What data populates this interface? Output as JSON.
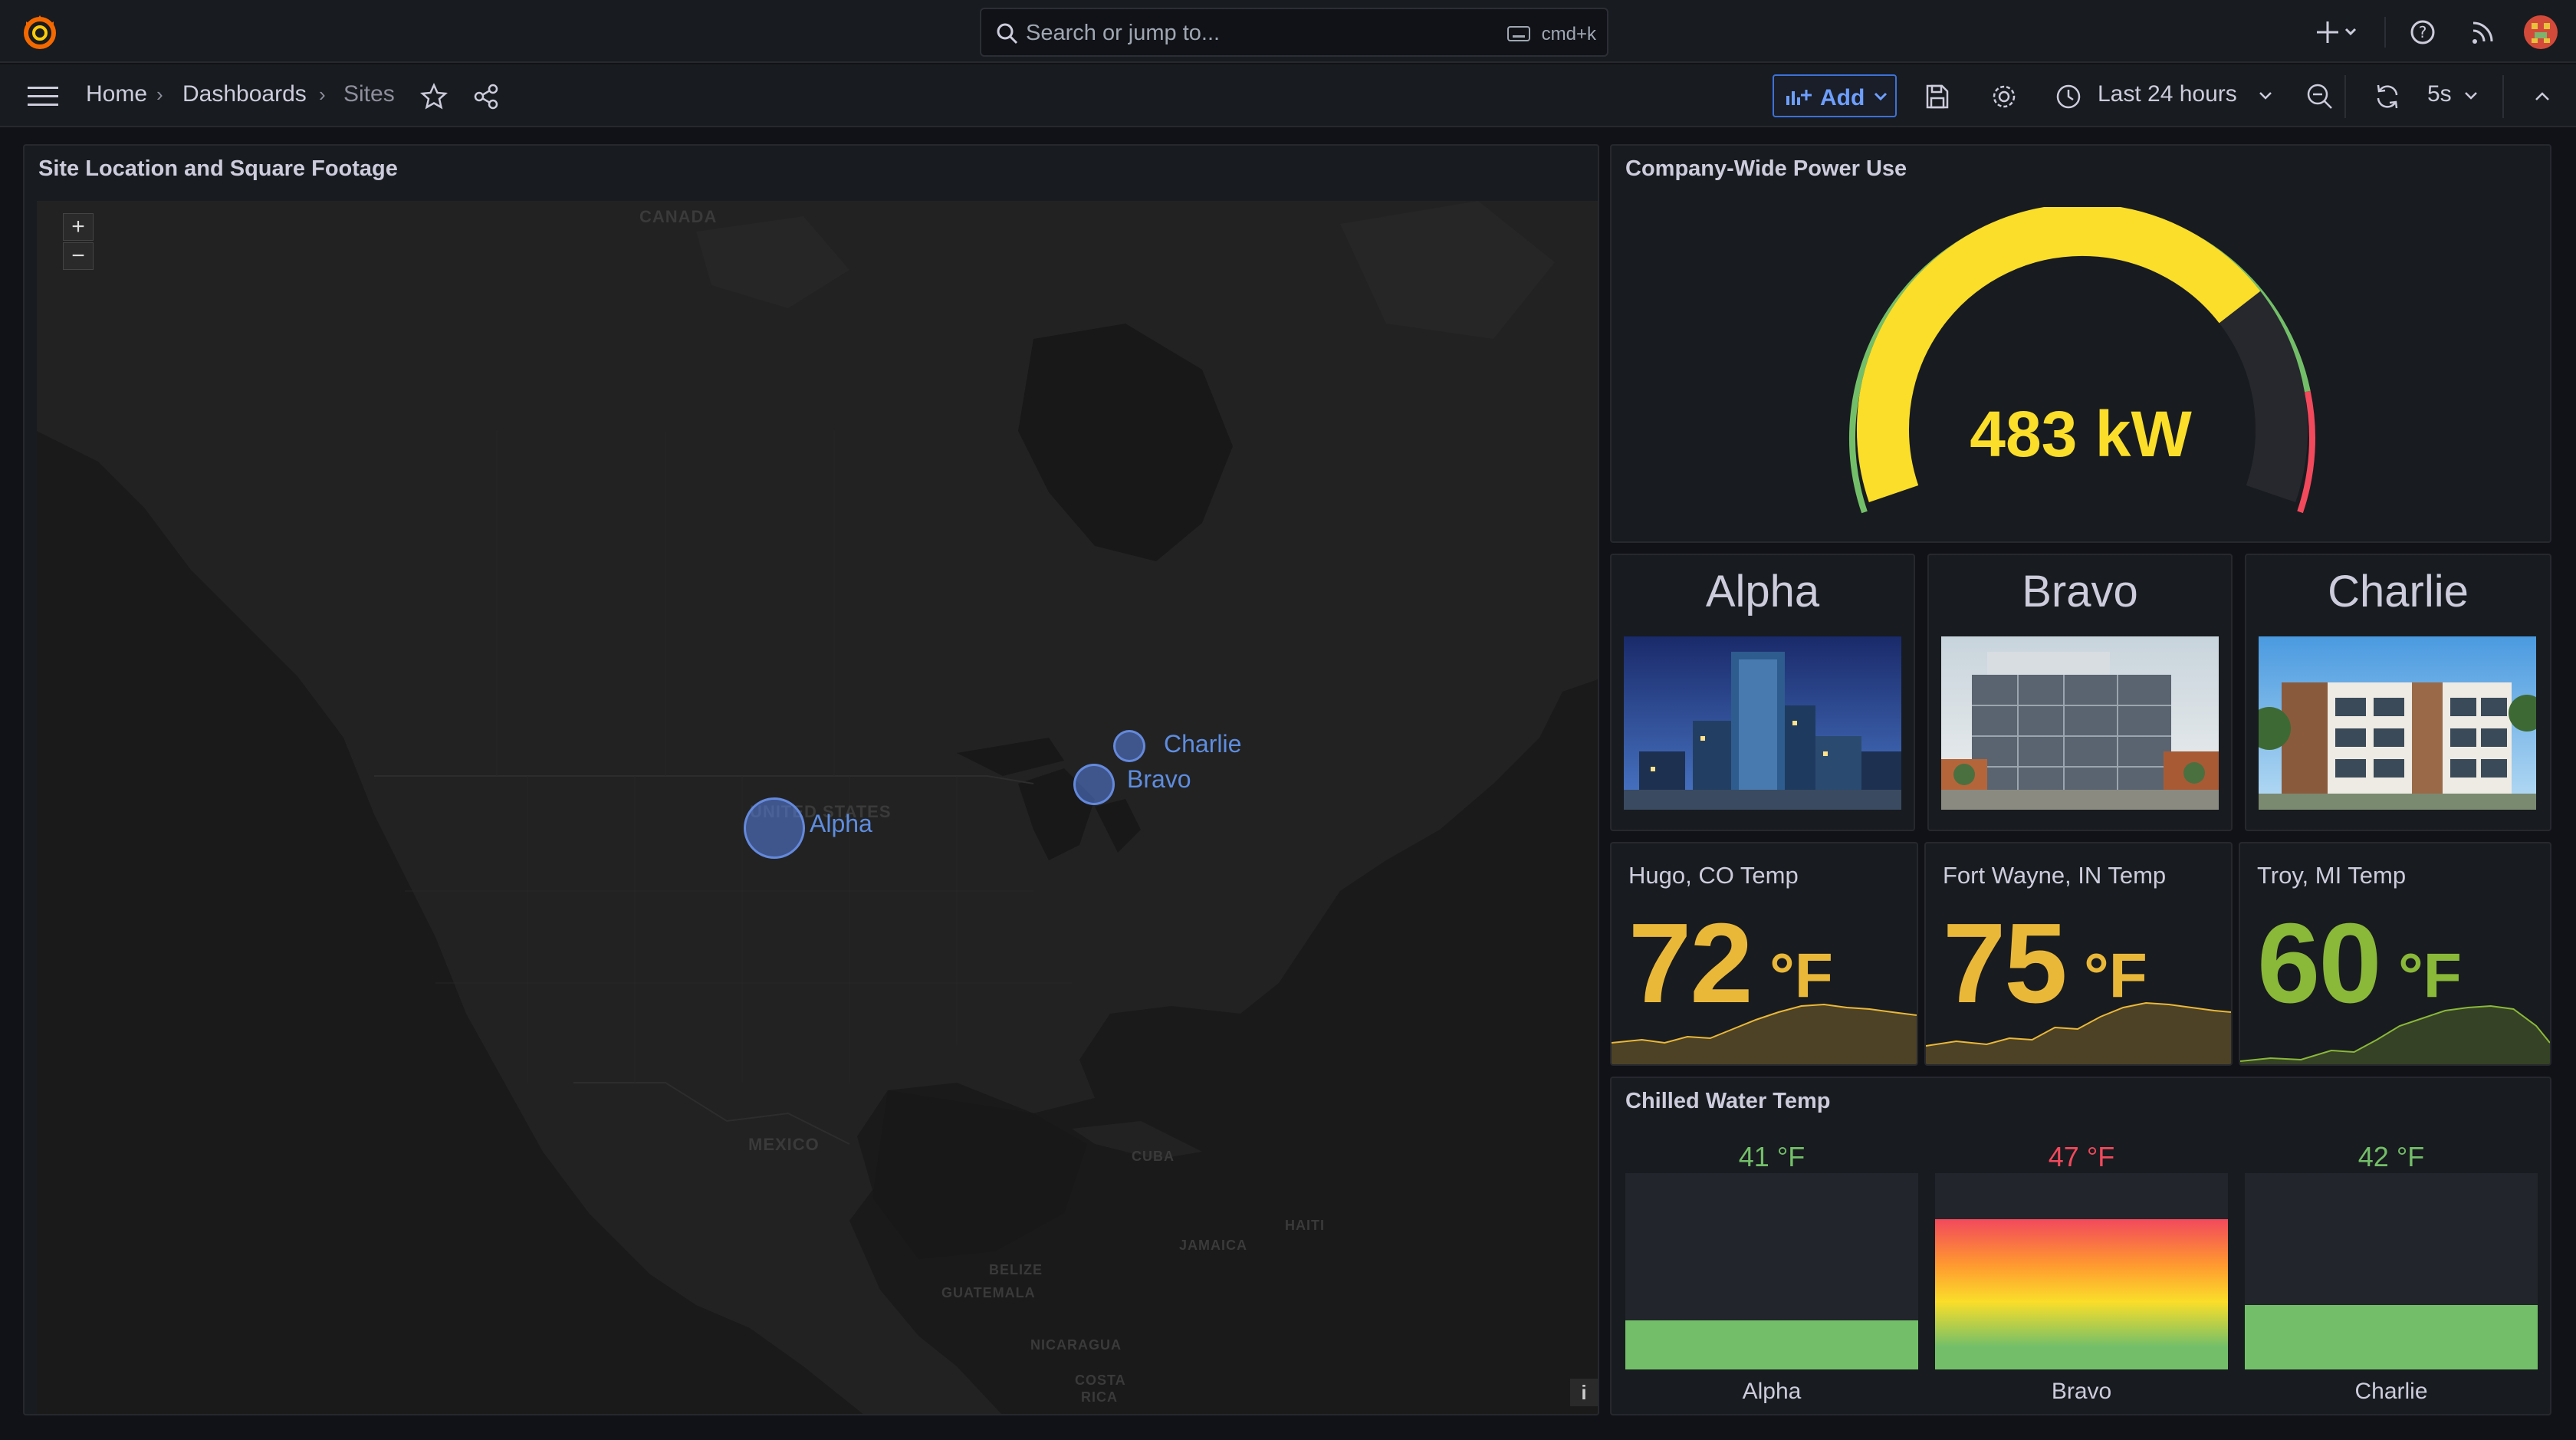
{
  "search": {
    "placeholder": "Search or jump to...",
    "shortcut": "cmd+k"
  },
  "breadcrumb": {
    "home": "Home",
    "dashboards": "Dashboards",
    "current": "Sites"
  },
  "toolbar": {
    "add_label": "Add",
    "time_range": "Last 24 hours",
    "refresh_interval": "5s"
  },
  "map_panel": {
    "title": "Site Location and Square Footage",
    "zoom_in": "+",
    "zoom_out": "−",
    "info": "i",
    "labels": {
      "canada": "CANADA",
      "united_states": "UNITED STATES",
      "mexico": "MEXICO",
      "cuba": "CUBA",
      "haiti": "HAITI",
      "jamaica": "JAMAICA",
      "belize": "BELIZE",
      "guatemala": "GUATEMALA",
      "nicaragua": "NICARAGUA",
      "costa": "COSTA",
      "rica": "RICA"
    },
    "markers": [
      {
        "name": "Alpha",
        "location": "Hugo, CO"
      },
      {
        "name": "Bravo",
        "location": "Fort Wayne, IN"
      },
      {
        "name": "Charlie",
        "location": "Troy, MI"
      }
    ]
  },
  "power_panel": {
    "title": "Company-Wide Power Use",
    "value": "483 kW",
    "colors": {
      "yellow": "#fade2a",
      "green": "#73bf69",
      "red": "#f2495c"
    }
  },
  "sites": [
    {
      "name": "Alpha"
    },
    {
      "name": "Bravo"
    },
    {
      "name": "Charlie"
    }
  ],
  "temps": [
    {
      "title": "Hugo, CO Temp",
      "value": "72",
      "unit": "°F",
      "color": "#eab839"
    },
    {
      "title": "Fort Wayne, IN Temp",
      "value": "75",
      "unit": "°F",
      "color": "#eab839"
    },
    {
      "title": "Troy, MI Temp",
      "value": "60",
      "unit": "°F",
      "color": "#8ab839"
    }
  ],
  "chilled_water": {
    "title": "Chilled Water Temp",
    "items": [
      {
        "name": "Alpha",
        "value": "41 °F",
        "color": "#73bf69"
      },
      {
        "name": "Bravo",
        "value": "47 °F",
        "color": "#f2495c"
      },
      {
        "name": "Charlie",
        "value": "42 °F",
        "color": "#73bf69"
      }
    ]
  }
}
